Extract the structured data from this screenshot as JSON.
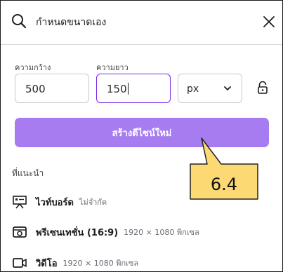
{
  "search": {
    "value": "กำหนดขนาดเอง",
    "search_icon": "search-icon",
    "close_icon": "close-icon"
  },
  "dimensions": {
    "width_label": "ความกว้าง",
    "width_value": "500",
    "height_label": "ความยาว",
    "height_value": "150",
    "unit_value": "px",
    "lock_icon": "padlock-icon"
  },
  "primary_button": {
    "label": "สร้างดีไซน์ใหม่",
    "color": "#a67cf0"
  },
  "suggestions": {
    "heading": "ที่แนะนำ",
    "items": [
      {
        "icon": "whiteboard-icon",
        "name": "ไวท์บอร์ด",
        "meta": "ไม่จำกัด"
      },
      {
        "icon": "presentation-icon",
        "name": "พรีเซนเทชั่น (16:9)",
        "meta": "1920 × 1080 พิกเซล"
      },
      {
        "icon": "video-icon",
        "name": "วิดีโอ",
        "meta": "1920 × 1080 พิกเซล"
      }
    ]
  },
  "annotation": {
    "label": "6.4",
    "color": "#fdd974"
  },
  "colors": {
    "accent": "#7d2ae8",
    "border": "#c9c9d0"
  }
}
